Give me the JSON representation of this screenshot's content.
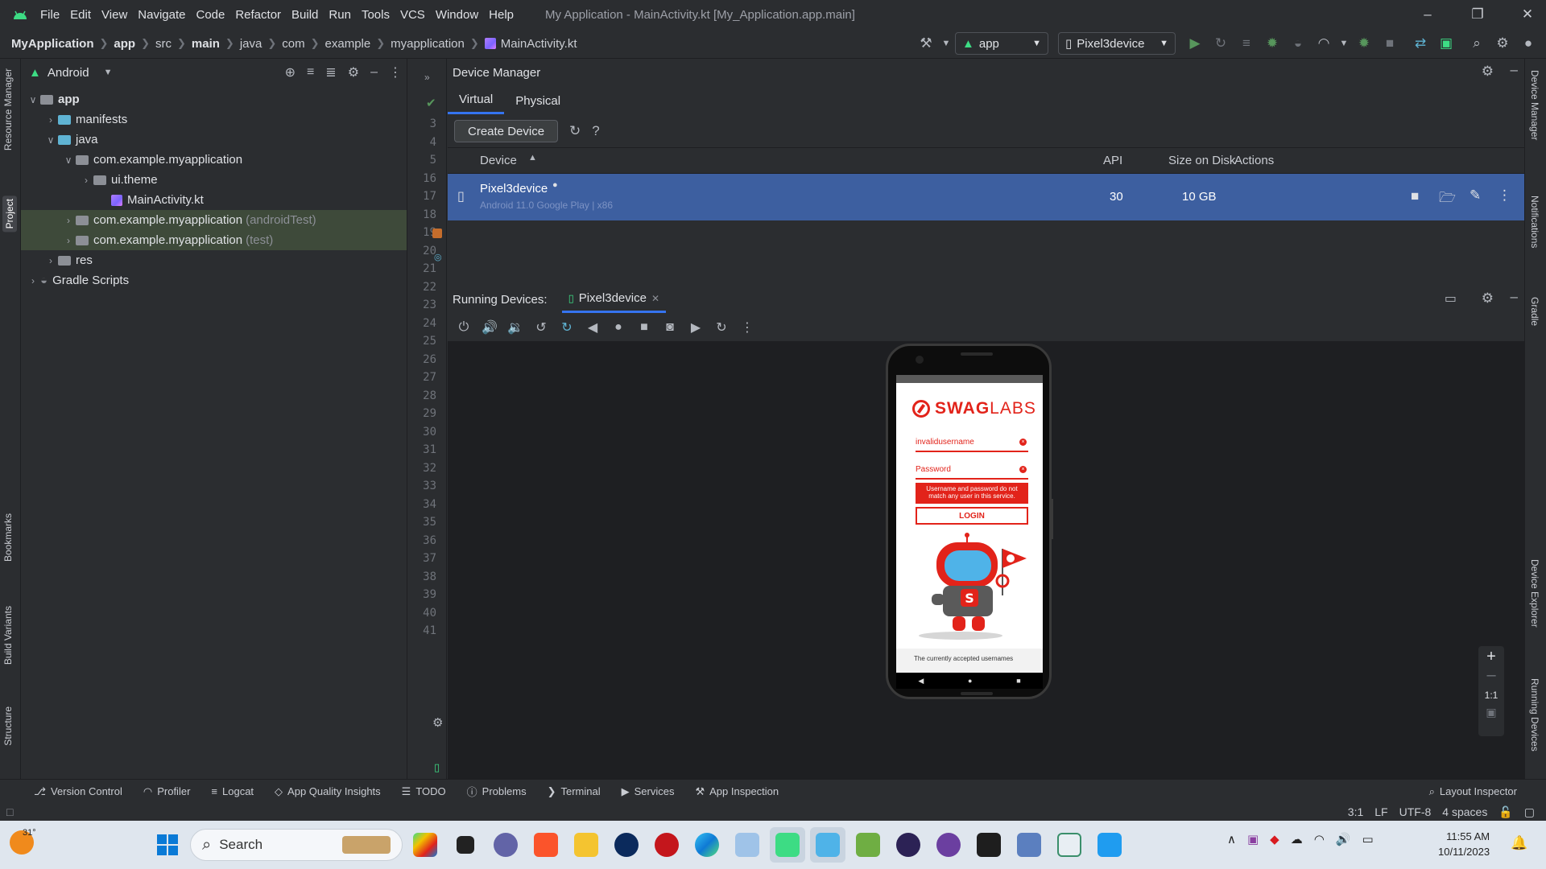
{
  "titlebar": {
    "menu": [
      "File",
      "Edit",
      "View",
      "Navigate",
      "Code",
      "Refactor",
      "Build",
      "Run",
      "Tools",
      "VCS",
      "Window",
      "Help"
    ],
    "window_title": "My Application - MainActivity.kt [My_Application.app.main]"
  },
  "breadcrumb": [
    "MyApplication",
    "app",
    "src",
    "main",
    "java",
    "com",
    "example",
    "myapplication",
    "MainActivity.kt"
  ],
  "run_config": {
    "module": "app",
    "device": "Pixel3device"
  },
  "left_tabs": [
    "Resource Manager",
    "Project",
    "Bookmarks",
    "Build Variants",
    "Structure"
  ],
  "project": {
    "view": "Android",
    "tree": [
      {
        "label": "app",
        "note": ""
      },
      {
        "label": "manifests",
        "note": ""
      },
      {
        "label": "java",
        "note": ""
      },
      {
        "label": "com.example.myapplication",
        "note": ""
      },
      {
        "label": "ui.theme",
        "note": ""
      },
      {
        "label": "MainActivity.kt",
        "note": ""
      },
      {
        "label": "com.example.myapplication",
        "note": "(androidTest)"
      },
      {
        "label": "com.example.myapplication",
        "note": "(test)"
      },
      {
        "label": "res",
        "note": ""
      },
      {
        "label": "Gradle Scripts",
        "note": ""
      }
    ]
  },
  "gutter_lines": [
    "3",
    "4",
    "5",
    "16",
    "17",
    "18",
    "19",
    "20",
    "21",
    "22",
    "23",
    "24",
    "25",
    "26",
    "27",
    "28",
    "29",
    "30",
    "31",
    "32",
    "33",
    "34",
    "35",
    "36",
    "37",
    "38",
    "39",
    "40",
    "41"
  ],
  "device_manager": {
    "title": "Device Manager",
    "tabs": [
      "Virtual",
      "Physical"
    ],
    "create_button": "Create Device",
    "columns": [
      "Device",
      "API",
      "Size on Disk",
      "Actions"
    ],
    "device": {
      "name": "Pixel3device",
      "subtitle": "Android 11.0 Google Play | x86",
      "api": "30",
      "size": "10 GB"
    }
  },
  "running_devices": {
    "label": "Running Devices:",
    "tab": "Pixel3device",
    "zoom_fit": "1:1"
  },
  "app_screen": {
    "brand_left": "SWAG",
    "brand_right": "LABS",
    "username_value": "invalidusername",
    "password_placeholder": "Password",
    "error_text": "Username and password do not match any user in this service.",
    "login_button": "LOGIN",
    "footer_text": "The currently accepted usernames"
  },
  "right_tabs": [
    "Device Manager",
    "Notifications",
    "Gradle",
    "Device Explorer",
    "Running Devices"
  ],
  "bottom_tools": [
    "Version Control",
    "Profiler",
    "Logcat",
    "App Quality Insights",
    "TODO",
    "Problems",
    "Terminal",
    "Services",
    "App Inspection"
  ],
  "bottom_right_tool": "Layout Inspector",
  "status": {
    "position": "3:1",
    "line_sep": "LF",
    "encoding": "UTF-8",
    "indent": "4 spaces"
  },
  "taskbar": {
    "weather": "31°",
    "search_placeholder": "Search",
    "time": "11:55 AM",
    "date": "10/11/2023"
  },
  "colors": {
    "accent": "#3574f0",
    "selection_row": "#3d5fa0",
    "brand_red": "#e2231a",
    "android_green": "#3ddc84"
  }
}
